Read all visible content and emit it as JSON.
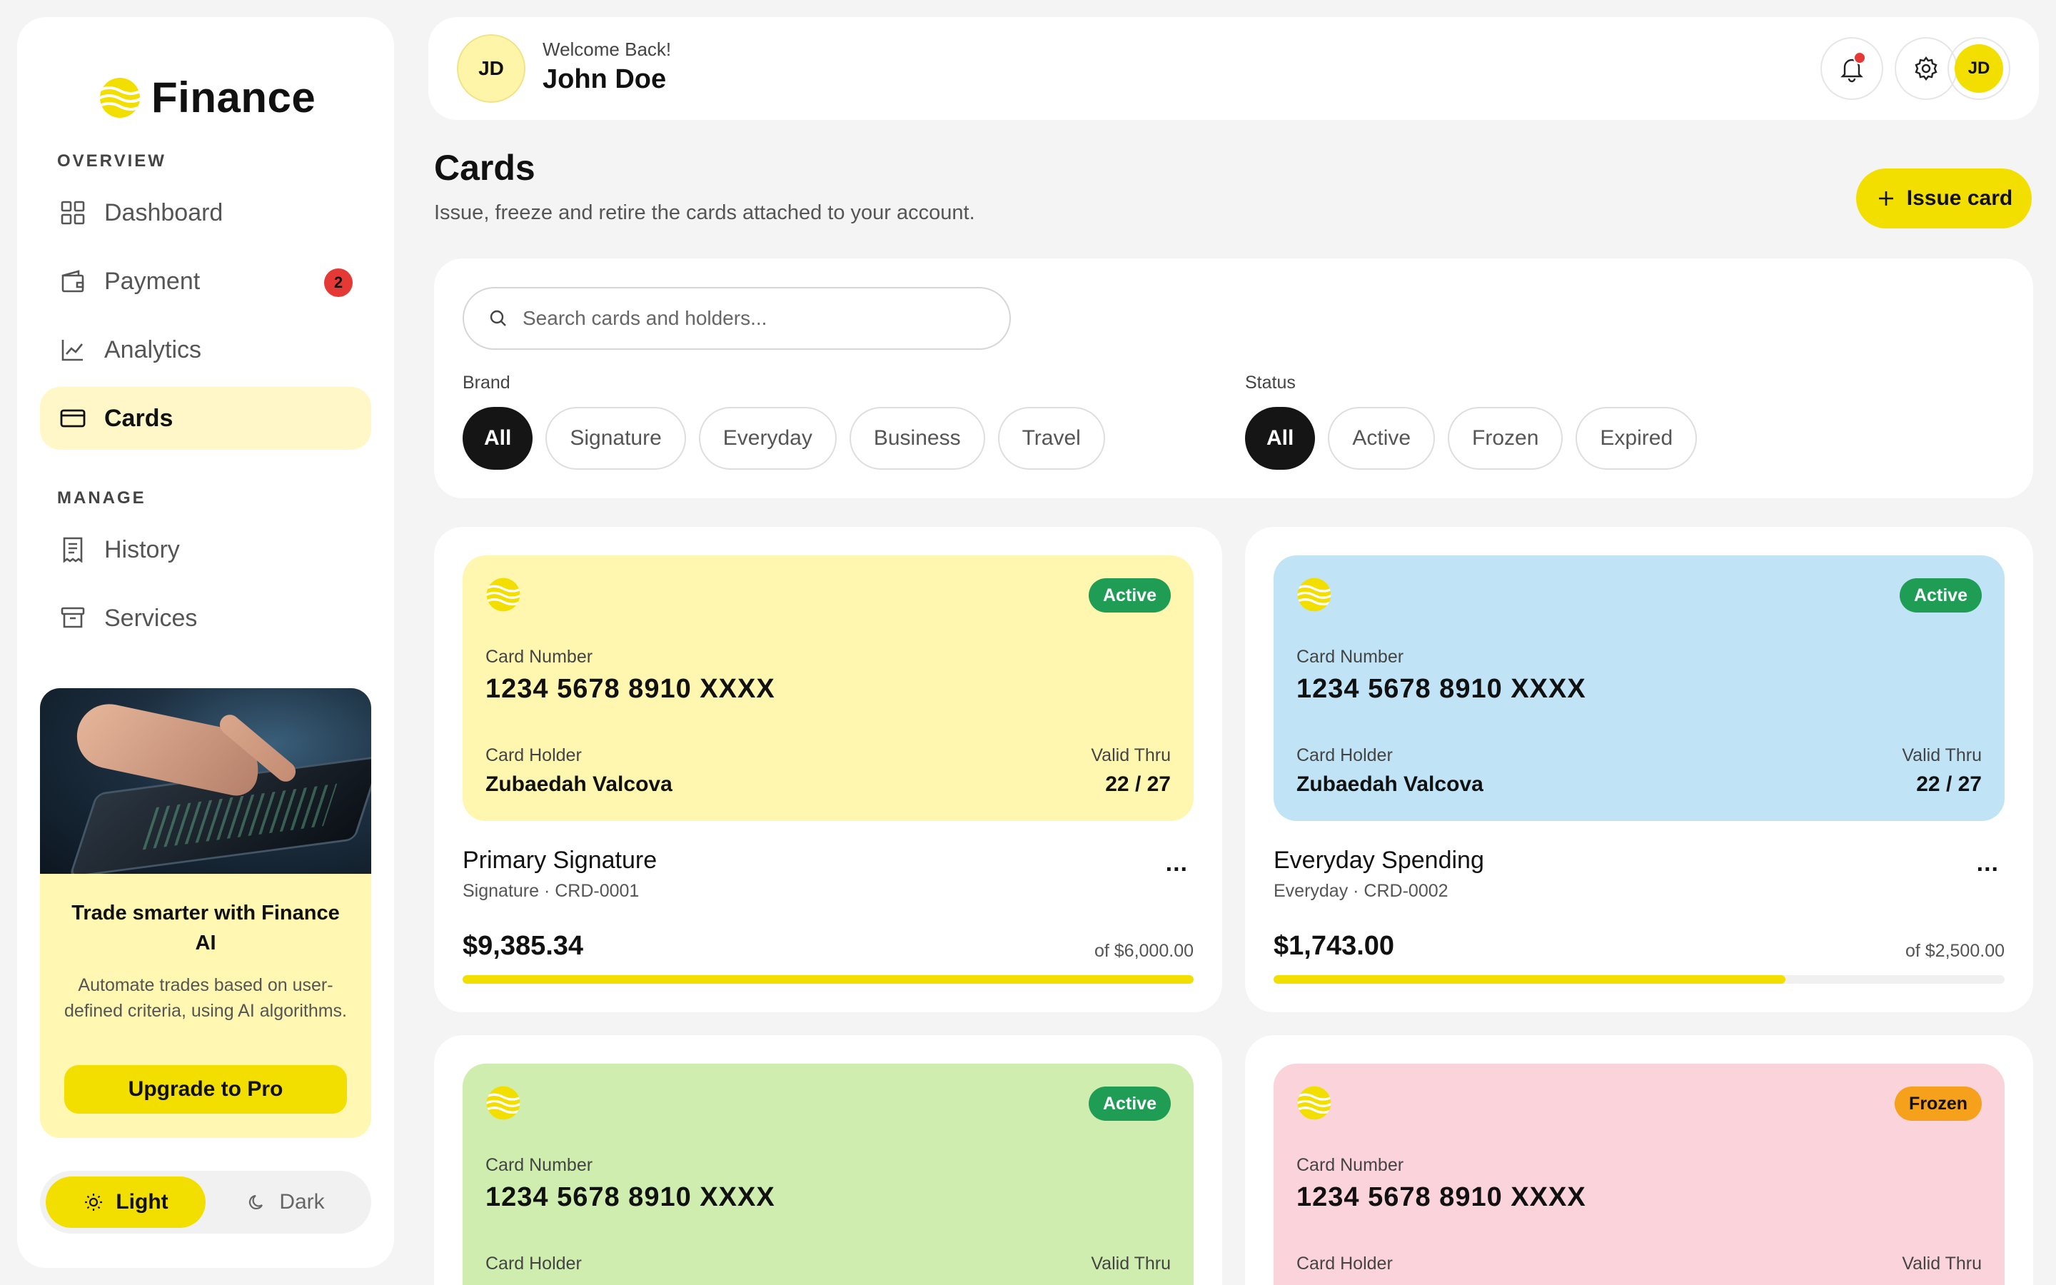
{
  "brand": {
    "name": "Finance"
  },
  "sidebar": {
    "overview_label": "OVERVIEW",
    "manage_label": "MANAGE",
    "items": [
      {
        "label": "Dashboard"
      },
      {
        "label": "Payment",
        "badge": "2"
      },
      {
        "label": "Analytics"
      },
      {
        "label": "Cards"
      },
      {
        "label": "History"
      },
      {
        "label": "Services"
      }
    ],
    "promo": {
      "title": "Trade smarter with Finance AI",
      "description": "Automate trades based on user-defined criteria, using AI algorithms.",
      "button": "Upgrade to Pro"
    },
    "theme": {
      "light": "Light",
      "dark": "Dark"
    }
  },
  "header": {
    "initials": "JD",
    "welcome": "Welcome Back!",
    "name": "John Doe",
    "avatar_initials": "JD"
  },
  "page": {
    "title": "Cards",
    "subtitle": "Issue, freeze and retire the cards attached to your account.",
    "issue_button": "Issue card"
  },
  "filters": {
    "search_placeholder": "Search cards and holders...",
    "brand_label": "Brand",
    "brand_options": [
      "All",
      "Signature",
      "Everyday",
      "Business",
      "Travel"
    ],
    "status_label": "Status",
    "status_options": [
      "All",
      "Active",
      "Frozen",
      "Expired"
    ]
  },
  "card_labels": {
    "number": "Card Number",
    "holder": "Card Holder",
    "valid": "Valid Thru"
  },
  "cards": [
    {
      "status": "Active",
      "number": "1234 5678 8910 XXXX",
      "holder": "Zubaedah Valcova",
      "valid": "22 / 27",
      "name": "Primary Signature",
      "meta": "Signature · CRD-0001",
      "balance": "$9,385.34",
      "limit": "of $6,000.00",
      "usage_fraction": 1.0,
      "more": "...",
      "color": "#fff6b0"
    },
    {
      "status": "Active",
      "number": "1234 5678 8910 XXXX",
      "holder": "Zubaedah Valcova",
      "valid": "22 / 27",
      "name": "Everyday Spending",
      "meta": "Everyday · CRD-0002",
      "balance": "$1,743.00",
      "limit": "of $2,500.00",
      "usage_fraction": 0.7,
      "more": "...",
      "color": "#c0e4f6"
    },
    {
      "status": "Active",
      "number": "1234 5678 8910 XXXX",
      "holder_label_only": true,
      "color": "#cfedae"
    },
    {
      "status": "Frozen",
      "number": "1234 5678 8910 XXXX",
      "holder_label_only": true,
      "color": "#fbd3da"
    }
  ],
  "colors": {
    "accent": "#f2df00",
    "active": "#1f9d55",
    "frozen": "#f5a11c",
    "badge": "#e53935"
  }
}
